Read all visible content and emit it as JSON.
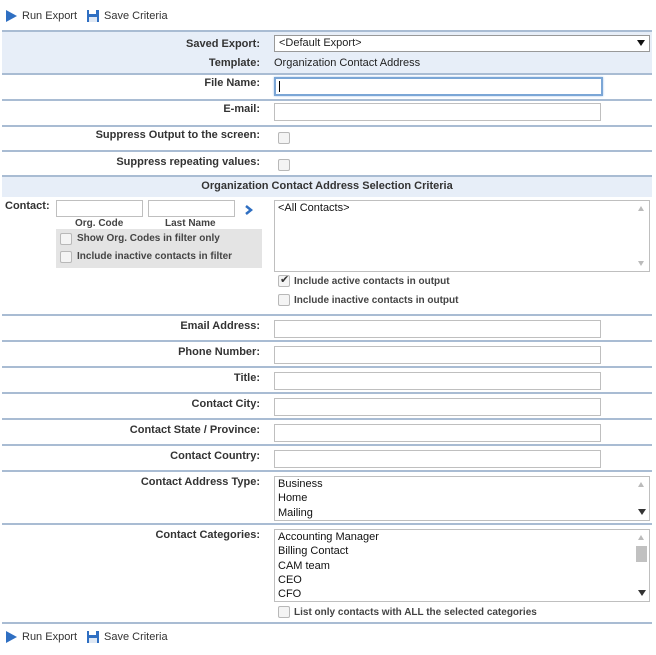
{
  "toolbar": {
    "run_export": "Run Export",
    "save_criteria": "Save Criteria"
  },
  "form": {
    "saved_export_label": "Saved Export:",
    "saved_export_value": "<Default Export>",
    "template_label": "Template:",
    "template_value": "Organization Contact Address",
    "file_name_label": "File Name:",
    "file_name_value": "",
    "email_label": "E-mail:",
    "email_value": "",
    "suppress_output_label": "Suppress Output to the screen:",
    "suppress_output_checked": false,
    "suppress_repeating_label": "Suppress repeating values:",
    "suppress_repeating_checked": false
  },
  "selection": {
    "section_title": "Organization Contact Address Selection Criteria",
    "contact_label": "Contact:",
    "org_code_label": "Org. Code",
    "last_name_label": "Last Name",
    "show_org_codes_label": "Show Org. Codes in filter only",
    "include_inactive_filter_label": "Include inactive contacts in filter",
    "contacts_list": [
      "<All Contacts>"
    ],
    "include_active_output_label": "Include active contacts in output",
    "include_active_output_checked": true,
    "include_inactive_output_label": "Include inactive contacts in output",
    "include_inactive_output_checked": false
  },
  "fields": {
    "email_address_label": "Email Address:",
    "phone_number_label": "Phone Number:",
    "title_label": "Title:",
    "contact_city_label": "Contact City:",
    "contact_state_label": "Contact State / Province:",
    "contact_country_label": "Contact Country:",
    "address_type_label": "Contact Address Type:",
    "address_types": [
      "Business",
      "Home",
      "Mailing"
    ],
    "categories_label": "Contact Categories:",
    "categories": [
      "Accounting Manager",
      "Billing Contact",
      "CAM team",
      "CEO",
      "CFO"
    ],
    "list_all_categories_label": "List only contacts with ALL the selected categories",
    "list_all_categories_checked": false
  },
  "colors": {
    "accent_blue": "#2f6fc2",
    "row_border": "#a9bcd3",
    "blue_row_bg": "#e7eef8"
  }
}
